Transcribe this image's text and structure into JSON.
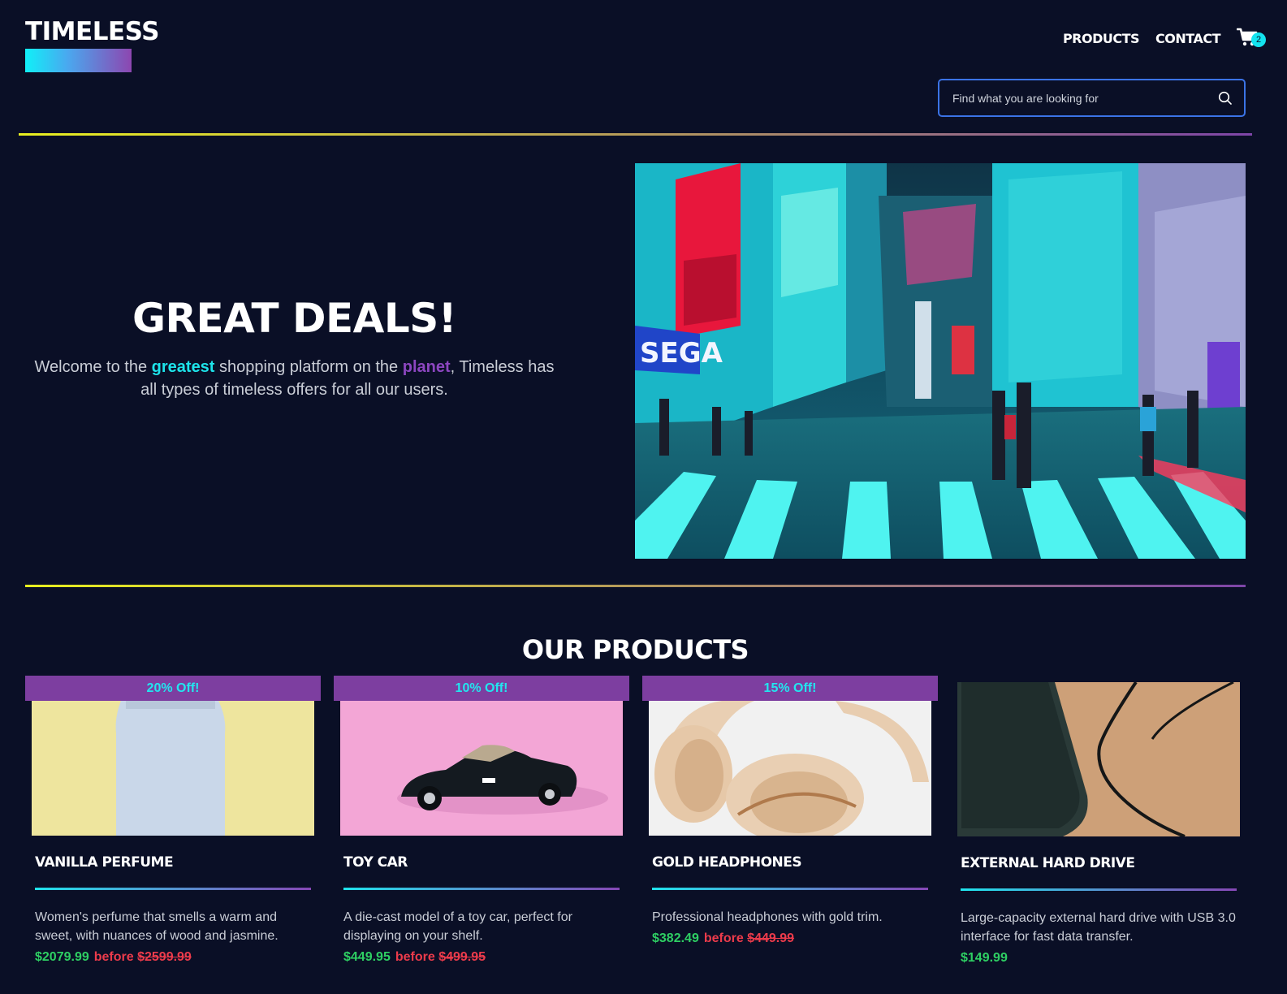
{
  "brand": {
    "name": "TIMELESS"
  },
  "nav": {
    "items": [
      {
        "label": "PRODUCTS"
      },
      {
        "label": "CONTACT"
      }
    ],
    "cart_count": "2"
  },
  "search": {
    "placeholder": "Find what you are looking for"
  },
  "hero": {
    "title": "GREAT DEALS!",
    "desc_1": "Welcome to the ",
    "desc_highlight_1": "greatest",
    "desc_2": " shopping platform on the ",
    "desc_highlight_2": "planet",
    "desc_3": ", Timeless has all types of timeless offers for all our users."
  },
  "products": {
    "title": "OUR PRODUCTS",
    "before_label": "before",
    "items": [
      {
        "badge": "20% Off!",
        "name": "VANILLA PERFUME",
        "description": "Women's perfume that smells a warm and sweet, with nuances of wood and jasmine.",
        "price": "$2079.99",
        "old_price": "$2599.99"
      },
      {
        "badge": "10% Off!",
        "name": "TOY CAR",
        "description": "A die-cast model of a toy car, perfect for displaying on your shelf.",
        "price": "$449.95",
        "old_price": "$499.95"
      },
      {
        "badge": "15% Off!",
        "name": "GOLD HEADPHONES",
        "description": "Professional headphones with gold trim.",
        "price": "$382.49",
        "old_price": "$449.99"
      },
      {
        "name": "EXTERNAL HARD DRIVE",
        "description": "Large-capacity external hard drive with USB 3.0 interface for fast data transfer.",
        "price": "$149.99"
      }
    ]
  },
  "colors": {
    "background": "#0a0f26",
    "accent_cyan": "#1de3ea",
    "accent_purple": "#7d3ea0",
    "price_green": "#2ecf63",
    "price_red": "#ec3b4b",
    "search_border": "#3b73e6"
  },
  "icons": {
    "cart": "cart-icon",
    "search": "search-icon"
  }
}
